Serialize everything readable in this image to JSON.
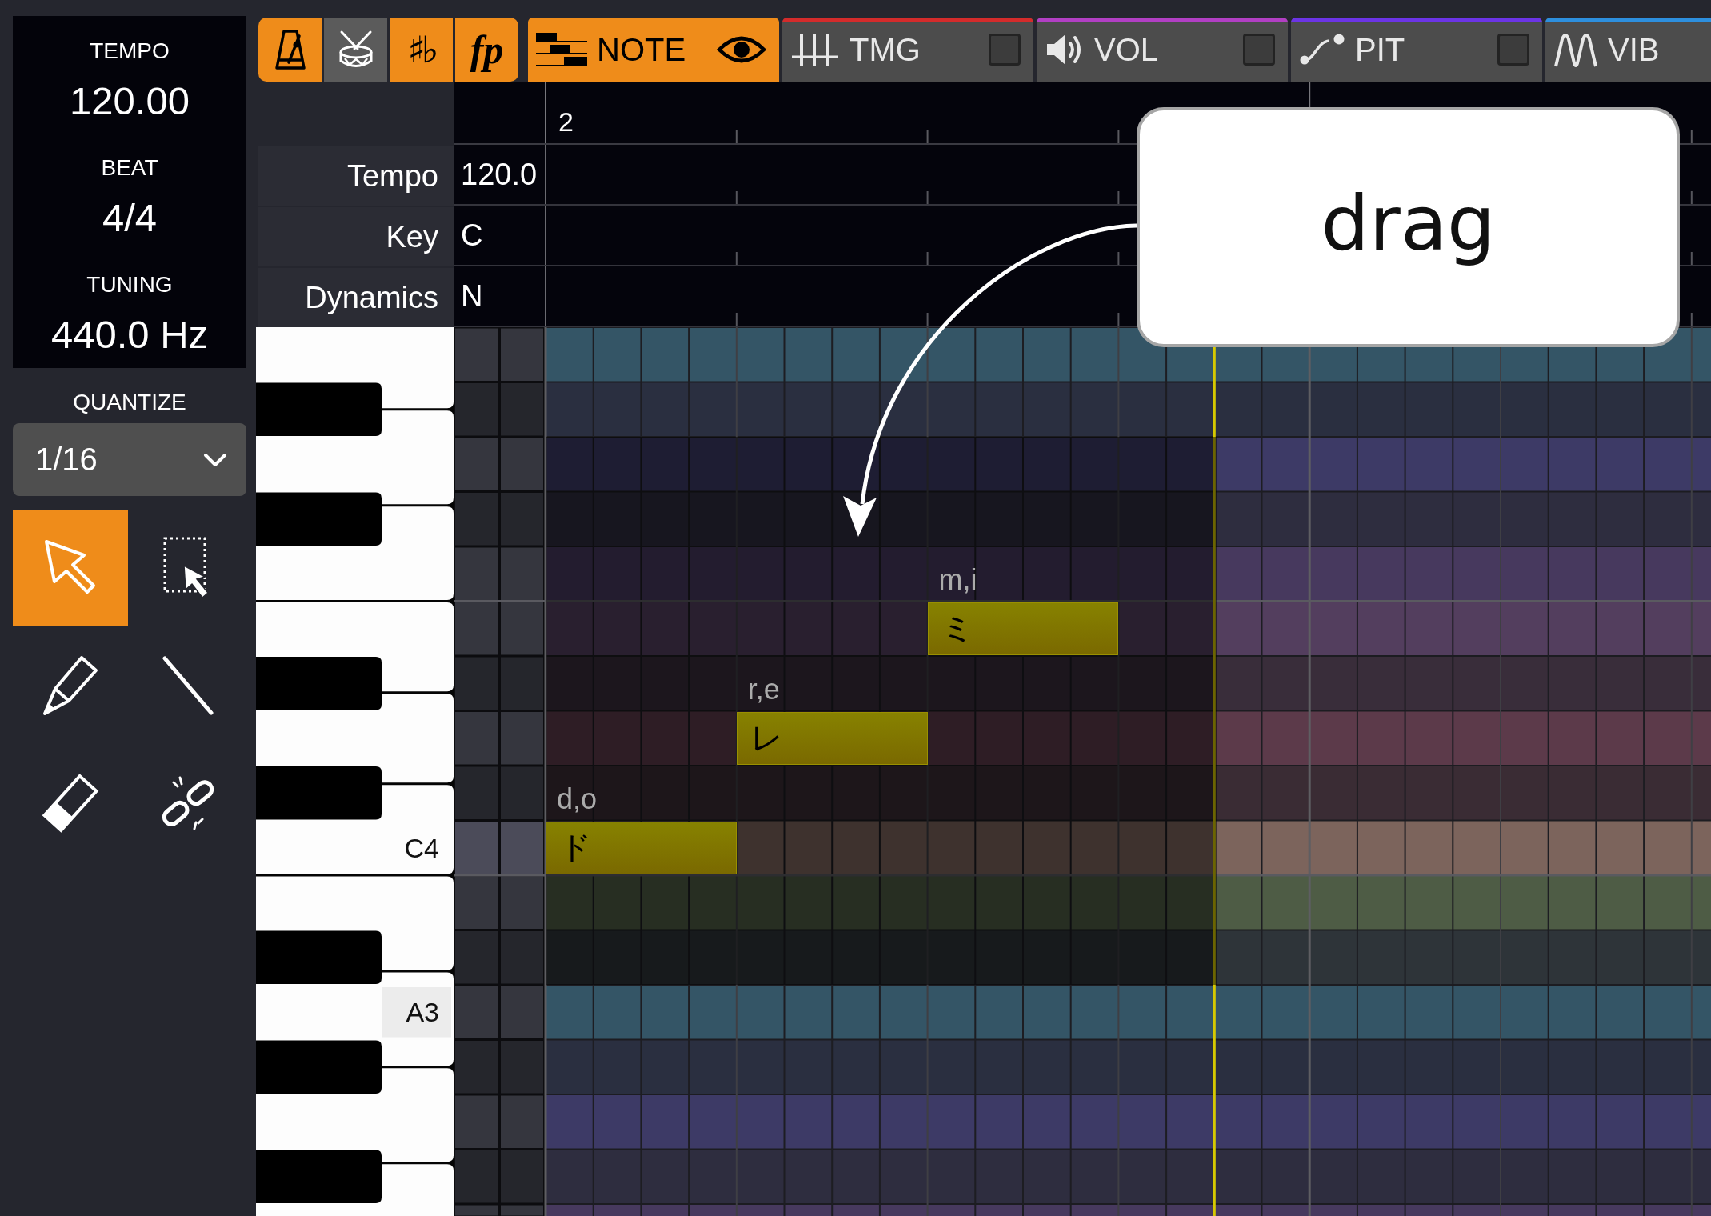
{
  "sidebar": {
    "status": [
      {
        "label": "TEMPO",
        "value": "120.00"
      },
      {
        "label": "BEAT",
        "value": "4/4"
      },
      {
        "label": "TUNING",
        "value": "440.0 Hz"
      }
    ],
    "quantize": {
      "label": "QUANTIZE",
      "value": "1/16"
    },
    "tools": [
      {
        "kind": "select",
        "selected": true
      },
      {
        "kind": "marquee",
        "selected": false
      },
      {
        "kind": "pencil",
        "selected": false
      },
      {
        "kind": "line",
        "selected": false
      },
      {
        "kind": "eraser",
        "selected": false
      },
      {
        "kind": "unlink",
        "selected": false
      }
    ]
  },
  "toolbar": {
    "toggles": [
      {
        "kind": "metronome",
        "on": true
      },
      {
        "kind": "drum",
        "on": false
      },
      {
        "kind": "accidentals",
        "glyph": "♯♭",
        "on": true
      },
      {
        "kind": "dynamics",
        "glyph": "fp",
        "on": true
      }
    ],
    "tabs": [
      {
        "kind": "note",
        "label": "NOTE",
        "selected": true,
        "toggle": {
          "kind": "eye",
          "on": true
        }
      },
      {
        "kind": "timing",
        "label": "TMG",
        "selected": false,
        "color": "#d42b2b",
        "toggle": {
          "kind": "checkbox",
          "on": false
        }
      },
      {
        "kind": "volume",
        "label": "VOL",
        "selected": false,
        "color": "#b23fc4",
        "toggle": {
          "kind": "checkbox",
          "on": false
        }
      },
      {
        "kind": "pitch",
        "label": "PIT",
        "selected": false,
        "color": "#6c34e6",
        "toggle": {
          "kind": "checkbox",
          "on": false
        }
      },
      {
        "kind": "vibrato",
        "label": "VIB",
        "selected": false,
        "color": "#2d8fde"
      }
    ]
  },
  "timeline": {
    "ruler": [
      "2"
    ],
    "tracks": [
      {
        "label": "Tempo",
        "value": "120.0"
      },
      {
        "label": "Key",
        "value": "C"
      },
      {
        "label": "Dynamics",
        "value": "N"
      }
    ]
  },
  "piano_roll": {
    "rows": [
      {
        "kind": "white",
        "color": "#345566",
        "highlighted": false
      },
      {
        "kind": "black",
        "color": "#2a2f40",
        "highlighted": false
      },
      {
        "kind": "white",
        "color": "#3d3a66",
        "highlighted": false
      },
      {
        "kind": "black",
        "color": "#2e2d3f",
        "highlighted": false
      },
      {
        "kind": "white",
        "color": "#47395e",
        "highlighted": false
      },
      {
        "kind": "white",
        "color": "#533e5e",
        "highlighted": false
      },
      {
        "kind": "black",
        "color": "#392d3a",
        "highlighted": false
      },
      {
        "kind": "white",
        "color": "#5c3a4a",
        "highlighted": false
      },
      {
        "kind": "black",
        "color": "#3a2c34",
        "highlighted": false
      },
      {
        "kind": "white",
        "color": "#7c645c",
        "highlighted": true,
        "label": {
          "text": "C4",
          "highlighted": false
        }
      },
      {
        "kind": "white",
        "color": "#4e5c45",
        "highlighted": false
      },
      {
        "kind": "black",
        "color": "#2e3439",
        "highlighted": false
      },
      {
        "kind": "white",
        "color": "#345566",
        "highlighted": false,
        "label": {
          "text": "A3",
          "highlighted": true
        }
      },
      {
        "kind": "black",
        "color": "#2a2f40",
        "highlighted": false
      },
      {
        "kind": "white",
        "color": "#3d3a66",
        "highlighted": false
      },
      {
        "kind": "black",
        "color": "#2e2d3f",
        "highlighted": false
      },
      {
        "kind": "white",
        "color": "#47395e",
        "highlighted": false
      }
    ],
    "notes": [
      {
        "lyric": "ド",
        "phonemes": "d,o"
      },
      {
        "lyric": "レ",
        "phonemes": "r,e"
      },
      {
        "lyric": "ミ",
        "phonemes": "m,i"
      }
    ]
  },
  "annotation": {
    "callout": "drag"
  }
}
